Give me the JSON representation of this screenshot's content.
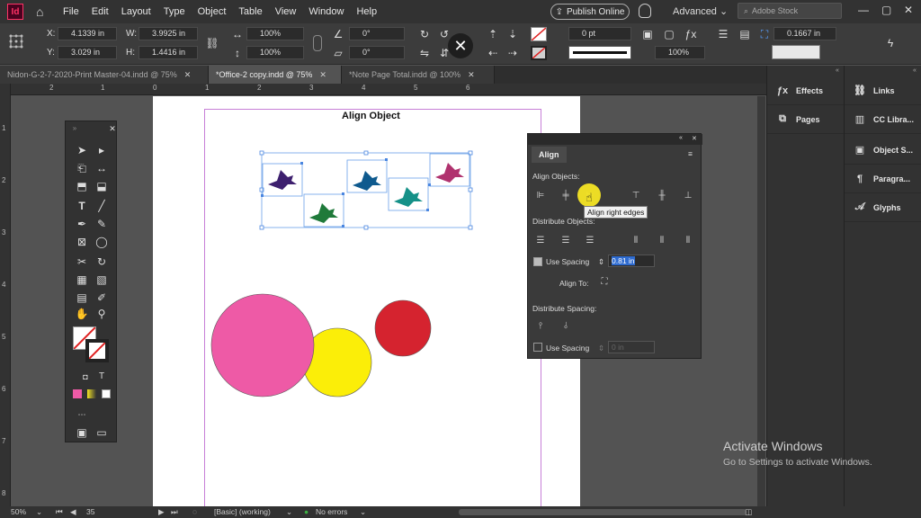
{
  "app": {
    "logo": "Id",
    "publish_label": "Publish Online",
    "workspace": "Advanced",
    "stock_placeholder": "Adobe Stock"
  },
  "menu": [
    "File",
    "Edit",
    "Layout",
    "Type",
    "Object",
    "Table",
    "View",
    "Window",
    "Help"
  ],
  "control": {
    "x_label": "X:",
    "x_value": "4.1339 in",
    "y_label": "Y:",
    "y_value": "3.029 in",
    "w_label": "W:",
    "w_value": "3.9925 in",
    "h_label": "H:",
    "h_value": "1.4416 in",
    "scale_x": "100%",
    "scale_y": "100%",
    "angle": "0°",
    "shear": "0°",
    "stroke_weight": "0 pt",
    "opacity": "100%",
    "offset": "0.1667 in"
  },
  "tabs": [
    {
      "label": "Nidon-G-2-7-2020-Print Master-04.indd @ 75%",
      "active": false
    },
    {
      "label": "*Office-2 copy.indd @ 75%",
      "active": true
    },
    {
      "label": "*Note Page  Total.indd @ 100%",
      "active": false
    }
  ],
  "ruler_h": [
    "2",
    "1",
    "0",
    "1",
    "2",
    "3",
    "4",
    "5",
    "6"
  ],
  "ruler_v": [
    "1",
    "2",
    "3",
    "4",
    "5",
    "6",
    "7",
    "8"
  ],
  "page": {
    "title": "Align Object"
  },
  "colors": {
    "bird1": "#3d1f6e",
    "bird2": "#1f7a3a",
    "bird3": "#0f5a8e",
    "bird4": "#159188",
    "bird5": "#b0326e",
    "pink": "#ee5aa6",
    "yellow": "#fbee08",
    "red": "#d5232f"
  },
  "align_panel": {
    "tab": "Align",
    "align_objects": "Align Objects:",
    "distribute_objects": "Distribute Objects:",
    "use_spacing": "Use Spacing",
    "spacing_value": "0.81 in",
    "align_to": "Align To:",
    "distribute_spacing": "Distribute Spacing:",
    "use_spacing2": "Use Spacing",
    "spacing_value2": "0 in",
    "tooltip": "Align right edges"
  },
  "right_panels": {
    "col1": [
      "Effects",
      "Pages"
    ],
    "col2": [
      "Links",
      "CC Libra...",
      "Object S...",
      "Paragra...",
      "Glyphs"
    ]
  },
  "status": {
    "zoom": "50%",
    "page": "35",
    "style": "[Basic] (working)",
    "errors": "No errors"
  },
  "watermark": {
    "title": "Activate Windows",
    "subtitle": "Go to Settings to activate Windows."
  }
}
